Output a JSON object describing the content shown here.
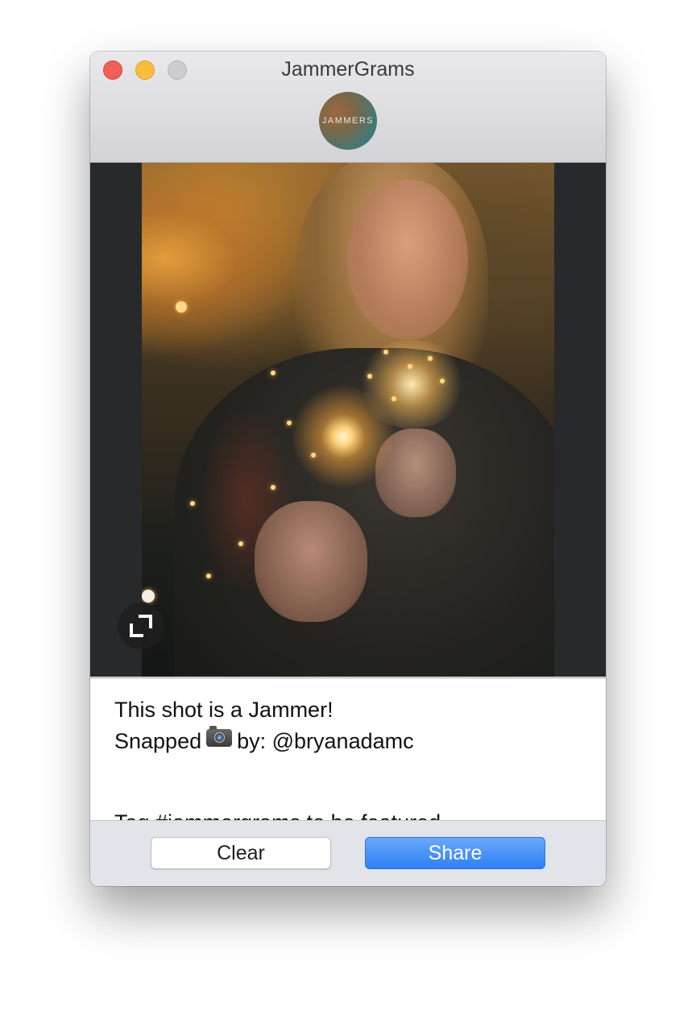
{
  "window": {
    "title": "JammerGrams",
    "logo_text": "JAMMERS"
  },
  "media": {
    "expand_icon": "expand-icon"
  },
  "caption": {
    "line1": "This shot is a Jammer!",
    "line2_prefix": "Snapped",
    "line2_icon": "camera-icon",
    "line2_suffix": "by: @bryanadamc",
    "line3_partial": "Tag #jammergrams to be featured"
  },
  "footer": {
    "clear_label": "Clear",
    "share_label": "Share"
  },
  "colors": {
    "close": "#ee5f57",
    "minimize": "#f7bd3e",
    "zoom_disabled": "#cdcdcf",
    "share_accent": "#3b86f7"
  }
}
